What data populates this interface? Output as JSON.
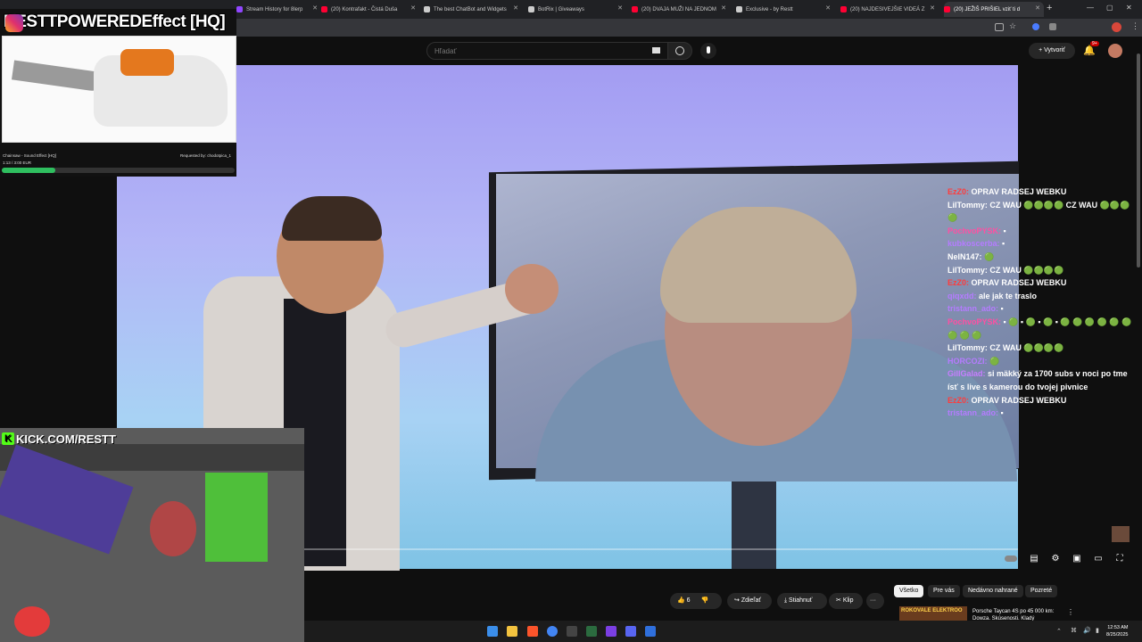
{
  "browser": {
    "tabs": [
      {
        "label": "Stream History for 8lerp",
        "color": "#9146ff"
      },
      {
        "label": "(20) Kontrafakt - Čistá Duša",
        "color": "#ff0033"
      },
      {
        "label": "The best ChatBot and Widgets",
        "color": "#cccccc"
      },
      {
        "label": "BotRix | Giveaways",
        "color": "#cccccc"
      },
      {
        "label": "(20) DVAJA MUŽI NA JEDNOM",
        "color": "#ff0033"
      },
      {
        "label": "Exclusive - by Restt",
        "color": "#cccccc"
      },
      {
        "label": "(20) NAJDESIVEJŠIE VIDEÁ Z",
        "color": "#ff0033"
      },
      {
        "label": "(20) JEŽIŠ PRIŠIEL vziť ti d",
        "color": "#ff0033"
      }
    ],
    "new_tab": "+"
  },
  "youtube": {
    "search_placeholder": "Hľadať",
    "create_label": "Vytvoriť",
    "notif_count": "9+"
  },
  "sfx_overlay": {
    "title": "RESTTPOWEREDEffect [HQ]",
    "name": "Chainsaw - Sound Effect [HQ]",
    "time": "1:13 / 3:00 EUR",
    "requested_by": "Requested by: chodotpica_1",
    "progress": 0.23
  },
  "webcam": {
    "brand": "KICK.COM/RESTT"
  },
  "chat": [
    {
      "user": "EzZ0:",
      "text": "OPRAV RADSEJ WEBKU",
      "color": "#ff3b3b"
    },
    {
      "user": "LilTommy:",
      "text": "CZ WAU 🟢🟢🟢🟢 CZ WAU 🟢🟢🟢🟢",
      "color": "#ffffff"
    },
    {
      "user": "PochvoPYSK:",
      "text": "▪",
      "color": "#ff4fa3"
    },
    {
      "user": "kubkoscerba:",
      "text": "▪",
      "color": "#b57bff"
    },
    {
      "user": "NelN147:",
      "text": "🟢",
      "color": "#ffffff"
    },
    {
      "user": "LilTommy:",
      "text": "CZ WAU 🟢🟢🟢🟢",
      "color": "#ffffff"
    },
    {
      "user": "EzZ0:",
      "text": "OPRAV RADSEJ WEBKU",
      "color": "#ff3b3b"
    },
    {
      "user": "qiqxdd:",
      "text": "ale jak te traslo",
      "color": "#b57bff"
    },
    {
      "user": "tristann_ado:",
      "text": "▪",
      "color": "#b57bff"
    },
    {
      "user": "PochvoPYSK:",
      "text": "▪ 🟢 ▪ 🟢 ▪ 🟢 ▪ 🟢 🟢 🟢 🟢 🟢 🟢 🟢 🟢 🟢",
      "color": "#ff4fa3"
    },
    {
      "user": "LilTommy:",
      "text": "CZ WAU 🟢🟢🟢🟢",
      "color": "#ffffff"
    },
    {
      "user": "HORCOZI:",
      "text": "🟢",
      "color": "#b57bff"
    },
    {
      "user": "GillGalad:",
      "text": "si mäkký za 1700 subs v noci po tme ísť s live s kamerou do tvojej pivnice",
      "color": "#c77dff"
    },
    {
      "user": "EzZ0:",
      "text": "OPRAV RADSEJ WEBKU",
      "color": "#ff3b3b"
    },
    {
      "user": "tristann_ado:",
      "text": "▪",
      "color": "#b57bff"
    }
  ],
  "actions": {
    "like_count": "6",
    "share": "Zdieľať",
    "download": "Stiahnuť",
    "clip": "Klip",
    "more": "···"
  },
  "filter_chips": [
    "Všetko",
    "Pre vás",
    "Nedávno nahrané",
    "Pozreté"
  ],
  "recommended": {
    "thumb_text": "ROKOVALE ELEKTROO",
    "title": "Porsche Taycan 4S po 45 000 km: Dowza. Skúsenosti. Kladý"
  },
  "taskbar": {
    "time": "12:53 AM",
    "date": "8/25/2025"
  }
}
